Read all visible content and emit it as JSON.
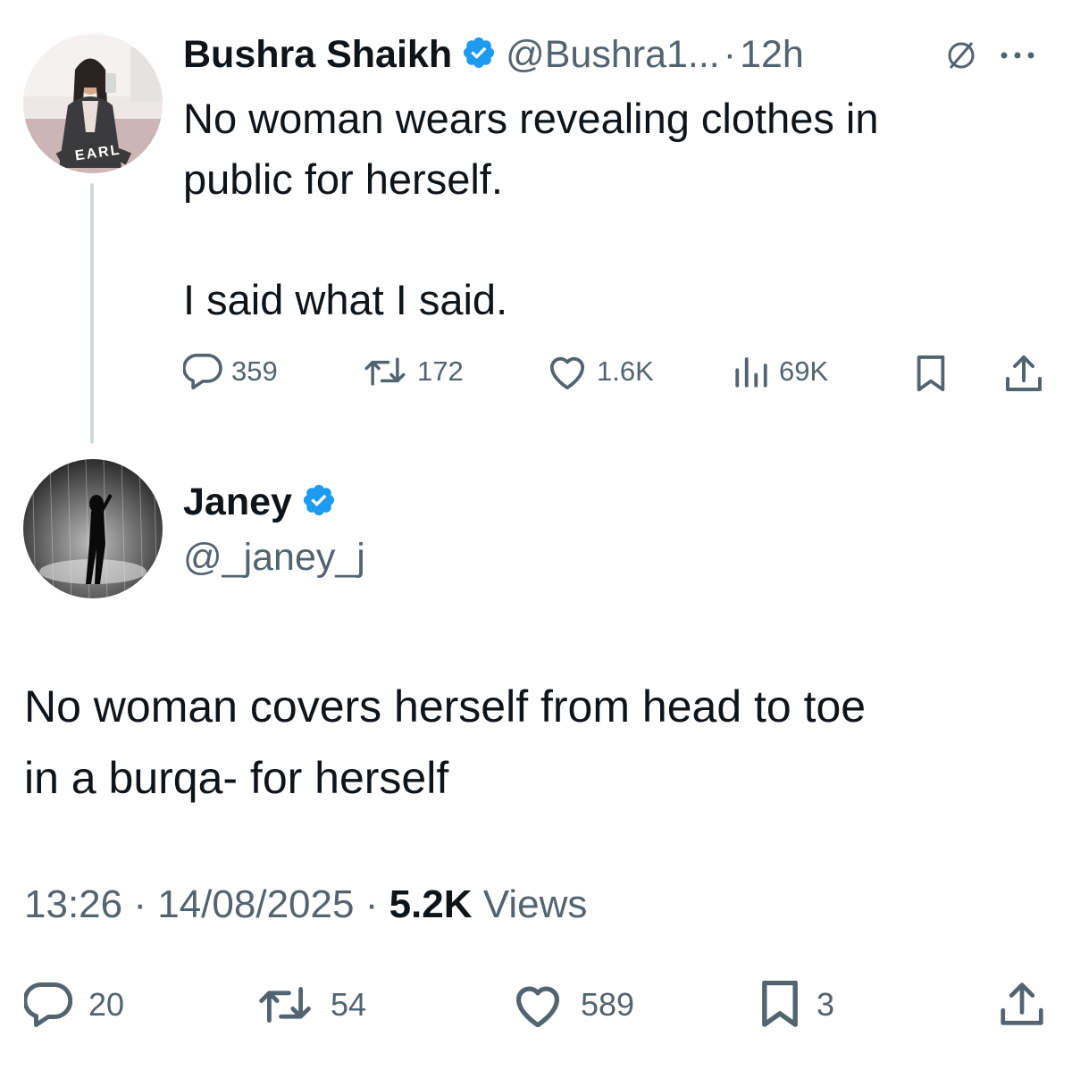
{
  "parent_tweet": {
    "author_name": "Bushra Shaikh",
    "author_handle": "@Bushra1...",
    "separator": "·",
    "time_ago": "12h",
    "text_line1": "No woman wears revealing clothes in",
    "text_line2": "public for herself.",
    "text_line3": "I said what I said.",
    "stats": {
      "replies": "359",
      "retweets": "172",
      "likes": "1.6K",
      "views": "69K"
    },
    "avatar_badge_text": "EARL"
  },
  "reply_tweet": {
    "author_name": "Janey",
    "author_handle": "@_janey_j",
    "text_line1": "No woman covers herself from head to toe",
    "text_line2": "in a burqa- for herself",
    "time": "13:26",
    "dot": "·",
    "date": "14/08/2025",
    "views_count": "5.2K",
    "views_label": "Views",
    "stats": {
      "replies": "20",
      "retweets": "54",
      "likes": "589",
      "bookmarks": "3"
    }
  },
  "colors": {
    "verified": "#1d9bf0",
    "text_primary": "#0f1419",
    "text_secondary": "#536471",
    "thread_line": "#cfd9de"
  },
  "icons": [
    "comment-icon",
    "retweet-icon",
    "heart-icon",
    "views-icon",
    "bookmark-icon",
    "share-icon",
    "verified-icon",
    "grok-icon",
    "more-icon"
  ]
}
